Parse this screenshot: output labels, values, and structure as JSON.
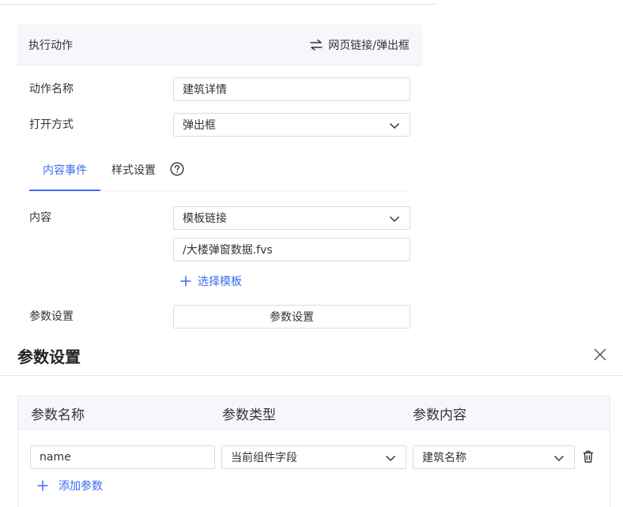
{
  "action_panel": {
    "title": "执行动作",
    "action_type": "网页链接/弹出框",
    "action_type_icon": "switch-arrows-icon"
  },
  "form": {
    "action_name_label": "动作名称",
    "action_name_value": "建筑详情",
    "open_mode_label": "打开方式",
    "open_mode_value": "弹出框",
    "content_label": "内容",
    "content_type_value": "模板链接",
    "template_path_value": "/大楼弹窗数据.fvs",
    "select_template_label": "选择模板",
    "param_settings_label": "参数设置",
    "param_settings_button": "参数设置"
  },
  "tabs": [
    {
      "label": "内容事件",
      "active": true
    },
    {
      "label": "样式设置",
      "active": false
    }
  ],
  "dialog": {
    "title": "参数设置",
    "columns": [
      "参数名称",
      "参数类型",
      "参数内容"
    ],
    "rows": [
      {
        "name": "name",
        "type": "当前组件字段",
        "content": "建筑名称"
      }
    ],
    "add_param_label": "添加参数"
  },
  "colors": {
    "accent": "#3b6cf2",
    "header_bg": "#f5f7fa",
    "border": "#d9dce1"
  }
}
